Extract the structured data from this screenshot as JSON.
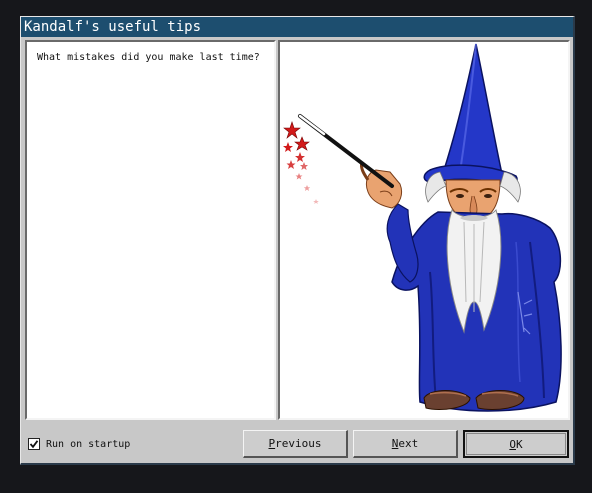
{
  "window": {
    "title": "Kandalf's useful tips"
  },
  "tip": {
    "text": "What mistakes did you make last time?"
  },
  "image": {
    "subject": "wizard-illustration"
  },
  "startup": {
    "label": "Run on startup",
    "checked": true
  },
  "buttons": {
    "previous_first": "P",
    "previous_rest": "revious",
    "next_first": "N",
    "next_rest": "ext",
    "ok_first": "O",
    "ok_rest": "K"
  },
  "colors": {
    "titlebar": "#1d4e6f",
    "robe": "#2233b8",
    "window_bg": "#c8c8c8"
  }
}
